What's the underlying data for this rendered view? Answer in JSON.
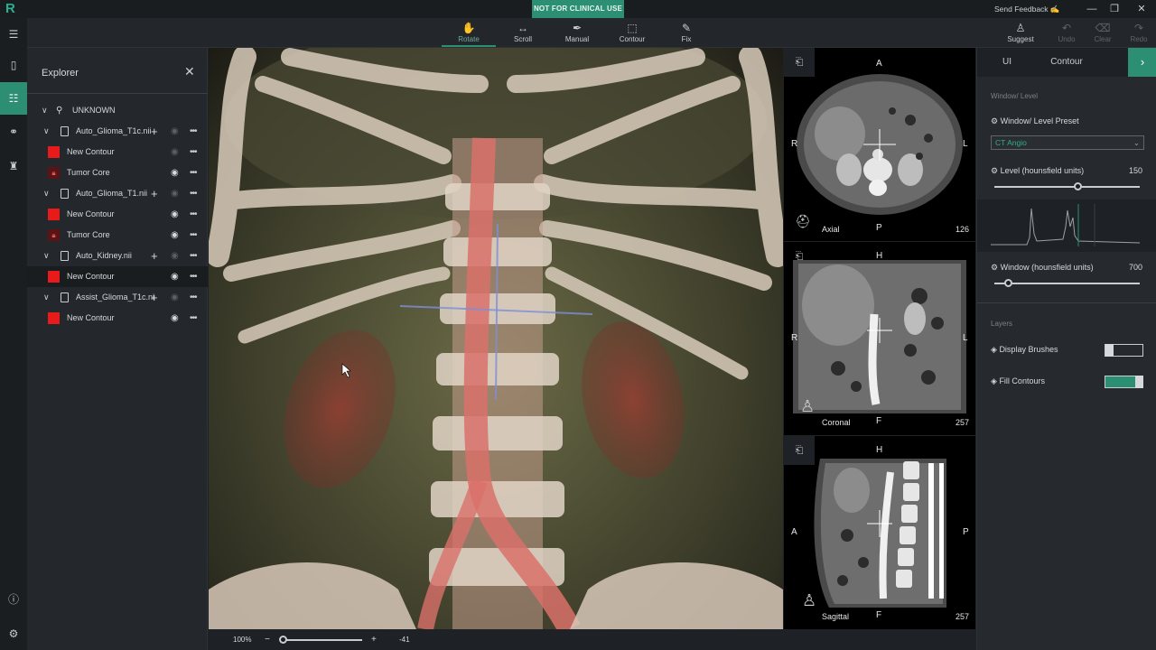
{
  "titlebar": {
    "banner": "NOT FOR CLINICAL USE",
    "send_feedback": "Send Feedback",
    "min_icon": "minimize-icon",
    "restore_icon": "restore-icon",
    "close_icon": "close-icon"
  },
  "toolbar": {
    "tools": [
      {
        "label": "Rotate",
        "state": "active",
        "icon": "hand-icon"
      },
      {
        "label": "Scroll",
        "state": "normal",
        "icon": "arrows-horizontal-icon"
      },
      {
        "label": "Manual",
        "state": "normal",
        "icon": "pen-icon"
      },
      {
        "label": "Contour",
        "state": "normal",
        "icon": "contour-box-icon"
      },
      {
        "label": "Fix",
        "state": "normal",
        "icon": "pencil-icon"
      }
    ],
    "right_tools": [
      {
        "label": "Suggest",
        "state": "normal",
        "icon": "suggest-icon"
      },
      {
        "label": "Undo",
        "state": "disabled",
        "icon": "undo-icon"
      },
      {
        "label": "Clear",
        "state": "disabled",
        "icon": "clear-icon"
      },
      {
        "label": "Redo",
        "state": "disabled",
        "icon": "redo-icon"
      }
    ]
  },
  "explorer": {
    "title": "Explorer",
    "root": "UNKNOWN",
    "items": [
      {
        "kind": "file",
        "label": "Auto_Glioma_T1c.nii",
        "eye": "dim"
      },
      {
        "kind": "contour",
        "label": "New Contour",
        "eye": "dim"
      },
      {
        "kind": "locked",
        "label": "Tumor Core",
        "eye": "on"
      },
      {
        "kind": "file",
        "label": "Auto_Glioma_T1.nii",
        "eye": "dim"
      },
      {
        "kind": "contour",
        "label": "New Contour",
        "eye": "on"
      },
      {
        "kind": "locked",
        "label": "Tumor Core",
        "eye": "on"
      },
      {
        "kind": "file",
        "label": "Auto_Kidney.nii",
        "eye": "dim"
      },
      {
        "kind": "contour",
        "label": "New Contour",
        "eye": "on",
        "selected": true
      },
      {
        "kind": "file",
        "label": "Assist_Glioma_T1c.ni",
        "eye": "dim"
      },
      {
        "kind": "contour",
        "label": "New Contour",
        "eye": "on"
      }
    ]
  },
  "view3d": {
    "zoom": "100%",
    "value": "-41",
    "zoom_fraction": 0.0
  },
  "slices": {
    "axial": {
      "name": "Axial",
      "number": "126",
      "top": "A",
      "bottom": "P",
      "left": "R",
      "right": "L"
    },
    "coronal": {
      "name": "Coronal",
      "number": "257",
      "top": "H",
      "bottom": "F",
      "left": "R",
      "right": "L"
    },
    "sagittal": {
      "name": "Sagittal",
      "number": "257",
      "top": "H",
      "bottom": "F",
      "left": "A",
      "right": "P"
    }
  },
  "rpanel": {
    "tabs": [
      "UI",
      "Contour"
    ],
    "section_window": "Window/ Level",
    "preset_label": "Window/ Level Preset",
    "preset_value": "CT Angio",
    "level_label": "Level (hounsfield units)",
    "level_value": "150",
    "level_fraction": 0.58,
    "window_label": "Window (hounsfield units)",
    "window_value": "700",
    "window_fraction": 0.1,
    "section_layers": "Layers",
    "display_brushes": "Display Brushes",
    "display_brushes_on": false,
    "fill_contours": "Fill Contours",
    "fill_contours_on": true
  },
  "colors": {
    "accent": "#2c8f74",
    "contour_red": "#e81b1b"
  }
}
